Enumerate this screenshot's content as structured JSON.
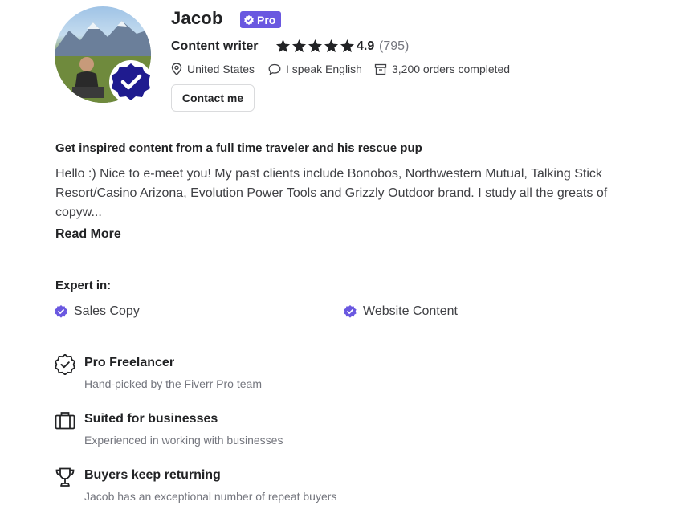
{
  "profile": {
    "name": "Jacob",
    "pro_badge": "Pro",
    "title": "Content writer",
    "rating": "4.9",
    "reviews_count": "795",
    "stars": 5,
    "country": "United States",
    "language": "I speak English",
    "orders": "3,200 orders completed",
    "contact_label": "Contact me"
  },
  "about": {
    "headline": "Get inspired content from a full time traveler and his rescue pup",
    "bio": "Hello :) Nice to e-meet you! My past clients include Bonobos, Northwestern Mutual, Talking Stick Resort/Casino Arizona, Evolution Power Tools and Grizzly Outdoor brand. I study all the greats of copyw...",
    "read_more": "Read More"
  },
  "expertise": {
    "label": "Expert in:",
    "items": [
      "Sales Copy",
      "Website Content"
    ]
  },
  "features": [
    {
      "icon": "verified-badge-icon",
      "title": "Pro Freelancer",
      "desc": "Hand-picked by the Fiverr Pro team"
    },
    {
      "icon": "briefcase-icon",
      "title": "Suited for businesses",
      "desc": "Experienced in working with businesses"
    },
    {
      "icon": "trophy-icon",
      "title": "Buyers keep returning",
      "desc": "Jacob has an exceptional number of repeat buyers"
    }
  ],
  "colors": {
    "pro_purple": "#6a58e0",
    "badge_navy": "#1f1b8f",
    "text_primary": "#222325",
    "text_secondary": "#74767e"
  }
}
